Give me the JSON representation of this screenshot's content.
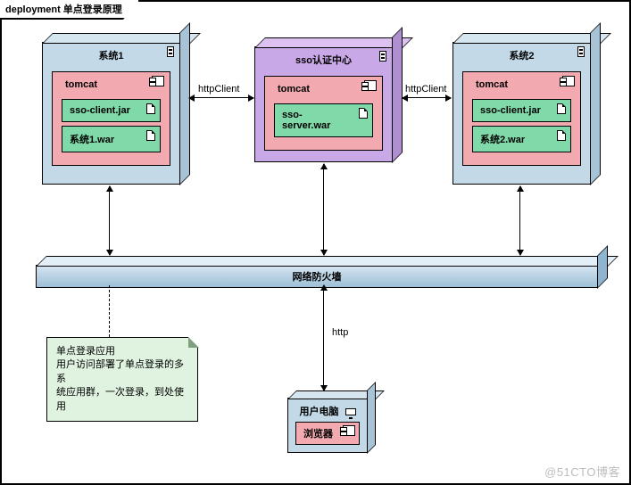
{
  "frame": {
    "title": "deployment 单点登录原理"
  },
  "nodes": {
    "system1": {
      "title": "系统1",
      "component": "tomcat",
      "artifacts": [
        "sso-client.jar",
        "系统1.war"
      ]
    },
    "sso": {
      "title": "sso认证中心",
      "component": "tomcat",
      "artifacts": [
        "sso-server.war"
      ]
    },
    "system2": {
      "title": "系统2",
      "component": "tomcat",
      "artifacts": [
        "sso-client.jar",
        "系统2.war"
      ]
    }
  },
  "firewall": {
    "label": "网络防火墙"
  },
  "client": {
    "title": "用户电脑",
    "browser": "浏览器"
  },
  "connectors": {
    "httpClient1": "httpClient",
    "httpClient2": "httpClient",
    "http": "http"
  },
  "note": {
    "line1": "单点登录应用",
    "line2": "用户访问部署了单点登录的多系",
    "line3": "统应用群，一次登录，到处使用"
  },
  "watermark": "@51CTO博客"
}
